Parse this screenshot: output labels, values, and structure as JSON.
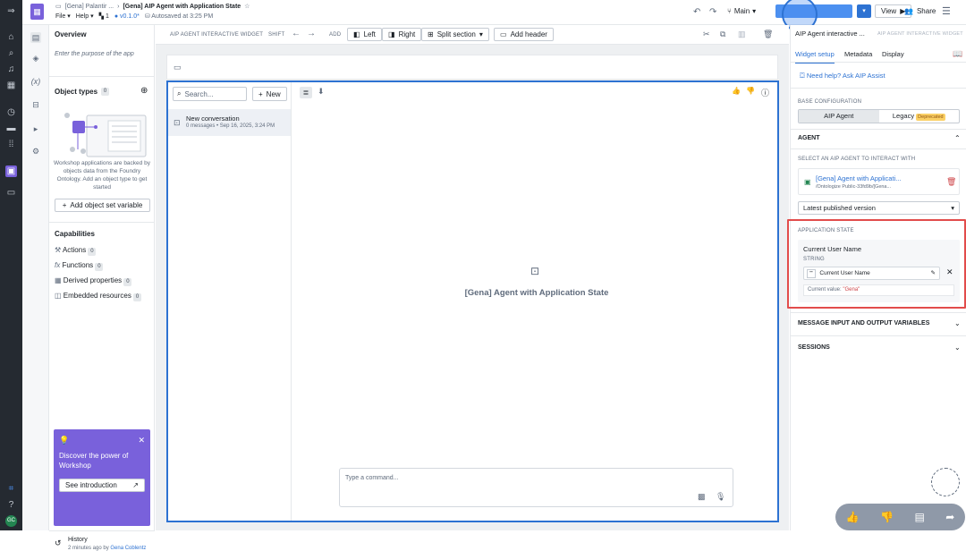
{
  "topbar": {
    "breadcrumb_parent": "[Gena] Palantir ...",
    "title": "[Gena] AIP Agent with Application State",
    "file_menu": "File",
    "help_menu": "Help",
    "pages_count": "1",
    "version": "v0.1.0*",
    "autosave": "Autosaved at 3:25 PM",
    "branch": "Main",
    "view_label": "View",
    "share_label": "Share"
  },
  "overview": {
    "title": "Overview",
    "purpose_placeholder": "Enter the purpose of the app",
    "object_types_title": "Object types",
    "object_types_count": "0",
    "info_text": "Workshop applications are backed by objects data from the Foundry Ontology. Add an object type to get started",
    "add_variable_label": "Add object set variable",
    "capabilities_title": "Capabilities",
    "capabilities": [
      {
        "label": "Actions",
        "count": "0"
      },
      {
        "label": "Functions",
        "count": "0"
      },
      {
        "label": "Derived properties",
        "count": "0"
      },
      {
        "label": "Embedded resources",
        "count": "0"
      }
    ],
    "promo_title": "Discover the power of Workshop",
    "promo_button": "See introduction",
    "history_title": "History",
    "history_sub": "2 minutes ago by",
    "history_user": "Gena Coblentz"
  },
  "toolbar": {
    "widget_label": "AIP AGENT INTERACTIVE WIDGET",
    "shift_label": "SHIFT",
    "add_label": "ADD",
    "left_label": "Left",
    "right_label": "Right",
    "split_label": "Split section",
    "add_header_label": "Add header"
  },
  "widget": {
    "search_placeholder": "Search...",
    "new_label": "New",
    "conversation_title": "New conversation",
    "conversation_meta": "0 messages • Sep 16, 2025, 3:24 PM",
    "agent_name": "[Gena] Agent with Application State",
    "command_placeholder": "Type a command..."
  },
  "config": {
    "header_title": "AIP Agent interactive ...",
    "header_type": "AIP AGENT INTERACTIVE WIDGET",
    "tabs": [
      "Widget setup",
      "Metadata",
      "Display"
    ],
    "help_link": "Need help? Ask AIP Assist",
    "base_config_label": "BASE CONFIGURATION",
    "seg_aip": "AIP Agent",
    "seg_legacy": "Legacy",
    "deprecated_badge": "Deprecated",
    "agent_section": "AGENT",
    "select_agent_label": "SELECT AN AIP AGENT TO INTERACT WITH",
    "agent_title": "[Gena] Agent with Applicati...",
    "agent_path": "/Ontologize Public-33fd9b/[Gena...",
    "version_select": "Latest published version",
    "app_state_label": "APPLICATION STATE",
    "var_name": "Current User Name",
    "var_type": "STRING",
    "var_chip": "Current User Name",
    "current_value_label": "Current value:",
    "current_value": "\"Gena\"",
    "msg_vars_section": "MESSAGE INPUT AND OUTPUT VARIABLES",
    "sessions_section": "SESSIONS"
  },
  "colors": {
    "accent": "#2d72d2",
    "highlight": "#e24c4b",
    "rail": "#252a31",
    "promo": "#7961db"
  }
}
